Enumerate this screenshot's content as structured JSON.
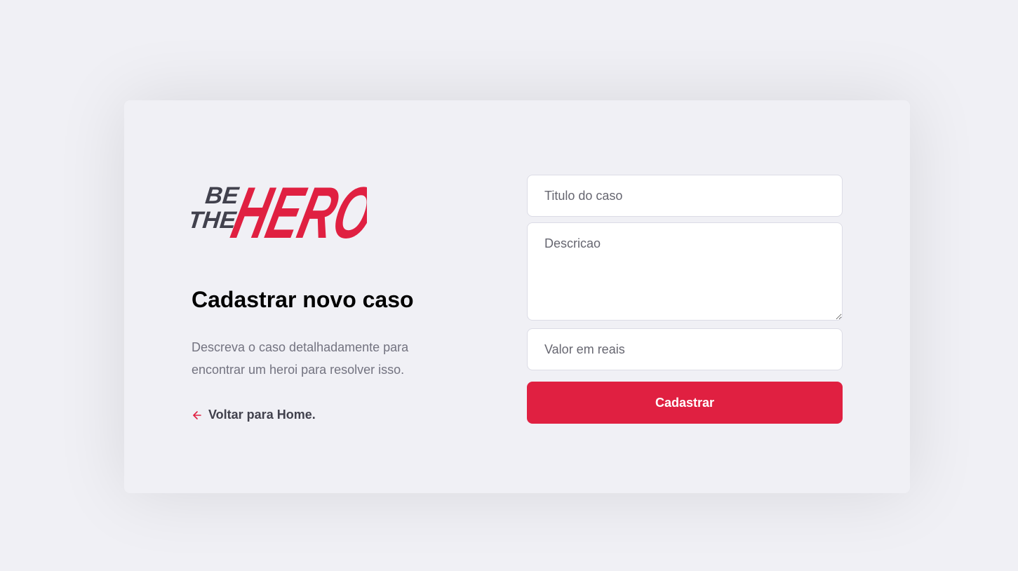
{
  "brand": {
    "logo_line1": "BE",
    "logo_line2": "THE",
    "logo_main": "HERO",
    "primary_color": "#e02041",
    "dark_color": "#41414d"
  },
  "page": {
    "title": "Cadastrar novo caso",
    "description": "Descreva o caso detalhadamente para encontrar um heroi para resolver isso.",
    "back_link_label": "Voltar para Home.",
    "back_icon": "arrow-left-icon"
  },
  "form": {
    "title_placeholder": "Titulo do caso",
    "description_placeholder": "Descricao",
    "value_placeholder": "Valor em reais",
    "submit_label": "Cadastrar"
  }
}
